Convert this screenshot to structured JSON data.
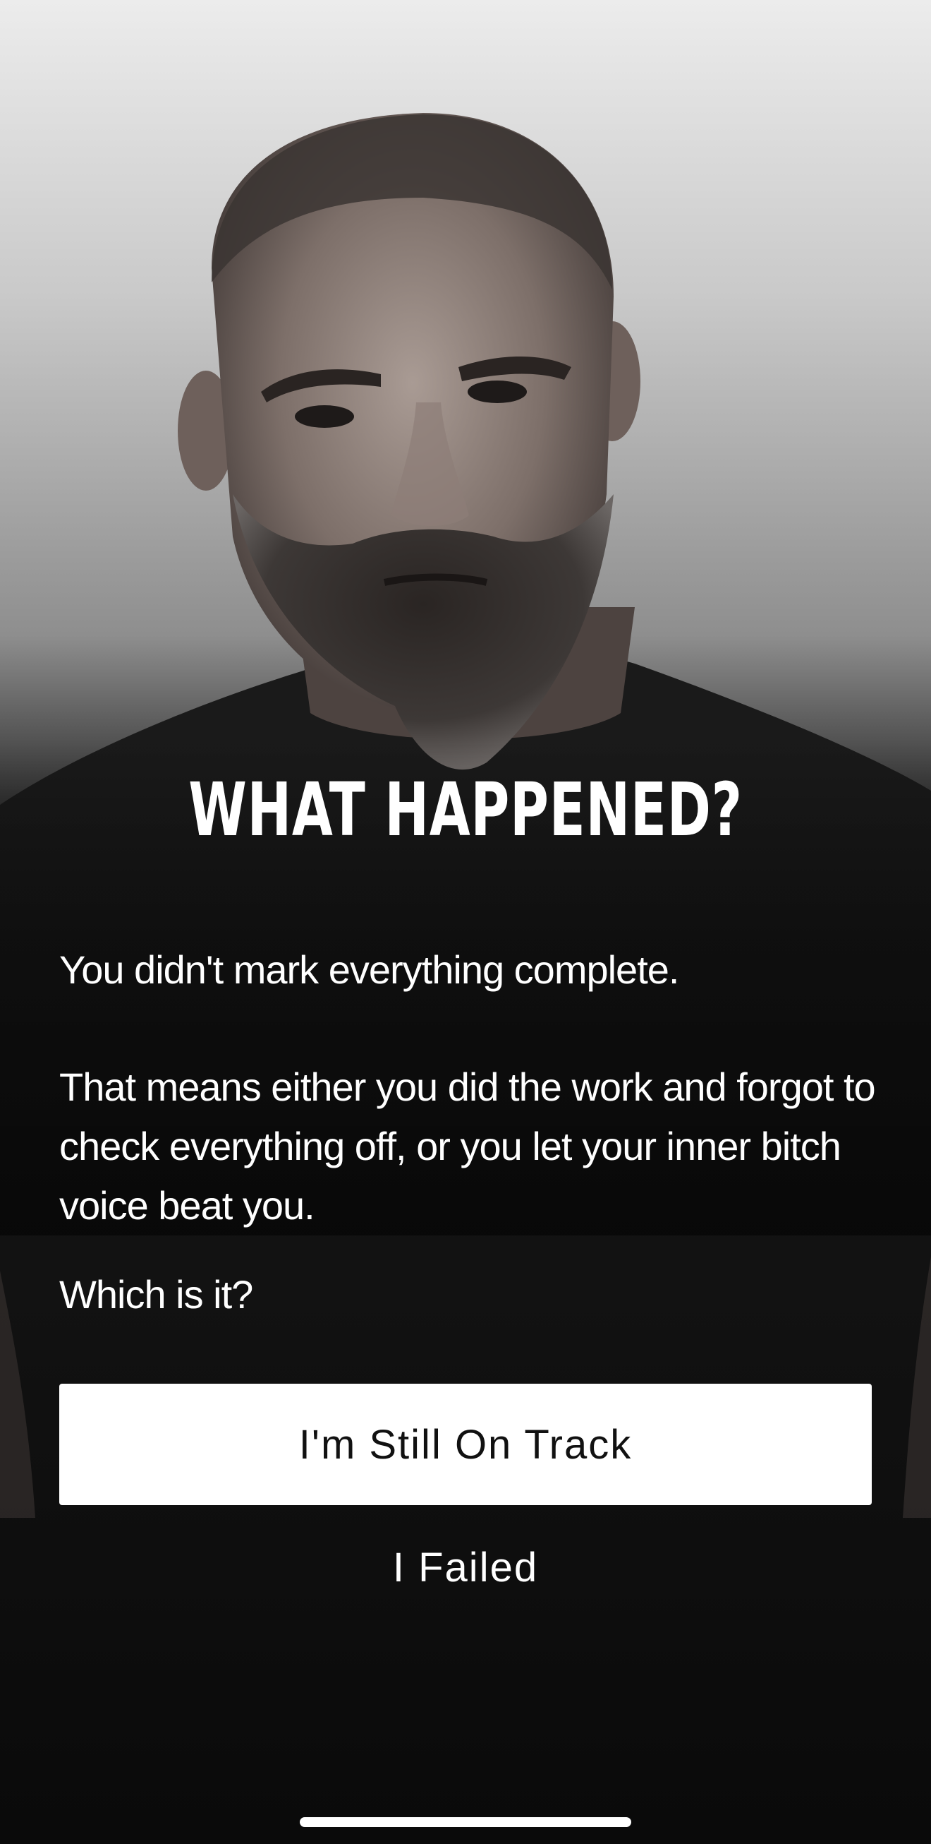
{
  "header": {
    "title": "WHAT HAPPENED?"
  },
  "message": {
    "line1": "You didn't mark everything complete.",
    "line2": "That means either you did the work and forgot to check everything off, or you let your inner bitch voice beat you.",
    "line3": "Which is it?"
  },
  "actions": {
    "primary_label": "I'm Still On Track",
    "secondary_label": "I Failed"
  },
  "colors": {
    "primary_button_bg": "#ffffff",
    "primary_button_text": "#111111",
    "text": "#ffffff",
    "background_dark": "#0b0b0b"
  }
}
